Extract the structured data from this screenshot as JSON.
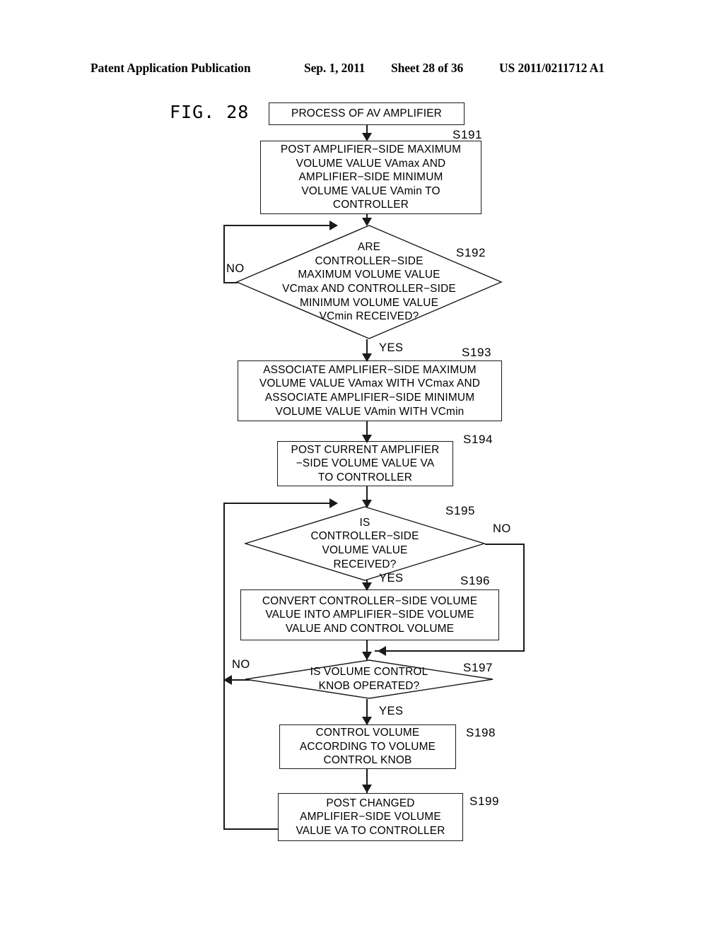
{
  "header": {
    "publication": "Patent Application Publication",
    "date": "Sep. 1, 2011",
    "sheet": "Sheet 28 of 36",
    "patent_number": "US 2011/0211712 A1"
  },
  "figure": {
    "label": "FIG.  28"
  },
  "flowchart": {
    "start": {
      "id": "",
      "text": "PROCESS OF AV AMPLIFIER"
    },
    "steps": [
      {
        "id": "S191",
        "type": "process",
        "text": "POST AMPLIFIER−SIDE MAXIMUM\nVOLUME VALUE VAmax AND\nAMPLIFIER−SIDE MINIMUM\nVOLUME VALUE VAmin TO\nCONTROLLER"
      },
      {
        "id": "S192",
        "type": "decision",
        "text": "ARE\nCONTROLLER−SIDE\nMAXIMUM VOLUME VALUE\nVCmax AND CONTROLLER−SIDE\nMINIMUM VOLUME VALUE\nVCmin RECEIVED?",
        "yes_label": "YES",
        "no_label": "NO"
      },
      {
        "id": "S193",
        "type": "process",
        "text": "ASSOCIATE AMPLIFIER−SIDE MAXIMUM\nVOLUME VALUE VAmax WITH VCmax AND\nASSOCIATE AMPLIFIER−SIDE MINIMUM\nVOLUME VALUE VAmin WITH VCmin"
      },
      {
        "id": "S194",
        "type": "process",
        "text": "POST CURRENT AMPLIFIER\n−SIDE VOLUME VALUE VA\nTO CONTROLLER"
      },
      {
        "id": "S195",
        "type": "decision",
        "text": "IS\nCONTROLLER−SIDE\nVOLUME VALUE\nRECEIVED?",
        "yes_label": "YES",
        "no_label": "NO"
      },
      {
        "id": "S196",
        "type": "process",
        "text": "CONVERT CONTROLLER−SIDE VOLUME\nVALUE INTO AMPLIFIER−SIDE VOLUME\nVALUE AND CONTROL VOLUME"
      },
      {
        "id": "S197",
        "type": "decision",
        "text": "IS VOLUME CONTROL\nKNOB OPERATED?",
        "yes_label": "YES",
        "no_label": "NO"
      },
      {
        "id": "S198",
        "type": "process",
        "text": "CONTROL VOLUME\nACCORDING TO VOLUME\nCONTROL KNOB"
      },
      {
        "id": "S199",
        "type": "process",
        "text": "POST CHANGED\nAMPLIFIER−SIDE VOLUME\nVALUE VA TO CONTROLLER"
      }
    ]
  },
  "colors": {
    "ink": "#1a1a1a",
    "paper": "#ffffff"
  }
}
